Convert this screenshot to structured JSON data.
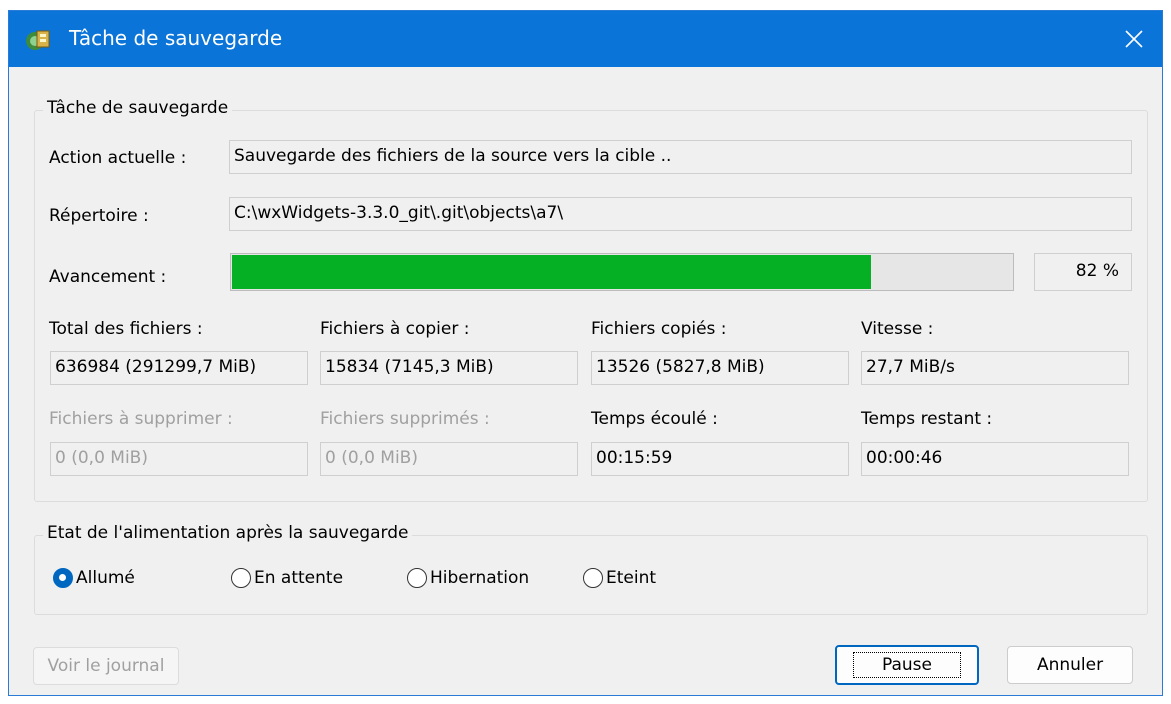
{
  "window": {
    "title": "Tâche de sauvegarde",
    "close_icon": "close-icon"
  },
  "task_group": {
    "label": "Tâche de sauvegarde",
    "current_action_label": "Action actuelle :",
    "current_action_value": "Sauvegarde des fichiers de la source vers la cible ..",
    "directory_label": "Répertoire :",
    "directory_value": "C:\\wxWidgets-3.3.0_git\\.git\\objects\\a7\\",
    "progress_label": "Avancement :",
    "progress_fraction": 0.82,
    "progress_text": "82 %",
    "stats": [
      {
        "label": "Total des fichiers :",
        "value": "636984 (291299,7 MiB)",
        "disabled": false
      },
      {
        "label": "Fichiers à copier :",
        "value": "15834 (7145,3 MiB)",
        "disabled": false
      },
      {
        "label": "Fichiers copiés :",
        "value": "13526 (5827,8 MiB)",
        "disabled": false
      },
      {
        "label": "Vitesse :",
        "value": "27,7 MiB/s",
        "disabled": false
      },
      {
        "label": "Fichiers à supprimer :",
        "value": "0 (0,0 MiB)",
        "disabled": true
      },
      {
        "label": "Fichiers supprimés :",
        "value": "0 (0,0 MiB)",
        "disabled": true
      },
      {
        "label": "Temps écoulé :",
        "value": "00:15:59",
        "disabled": false
      },
      {
        "label": "Temps restant :",
        "value": "00:00:46",
        "disabled": false
      }
    ]
  },
  "power_group": {
    "label": "Etat de l'alimentation après la sauvegarde",
    "options": [
      {
        "label": "Allumé",
        "checked": true
      },
      {
        "label": "En attente",
        "checked": false
      },
      {
        "label": "Hibernation",
        "checked": false
      },
      {
        "label": "Eteint",
        "checked": false
      }
    ]
  },
  "buttons": {
    "view_log": "Voir le journal",
    "pause": "Pause",
    "cancel": "Annuler"
  },
  "colors": {
    "titlebar": "#0a74d8",
    "progress": "#06b025",
    "radio_checked": "#0067c0"
  }
}
